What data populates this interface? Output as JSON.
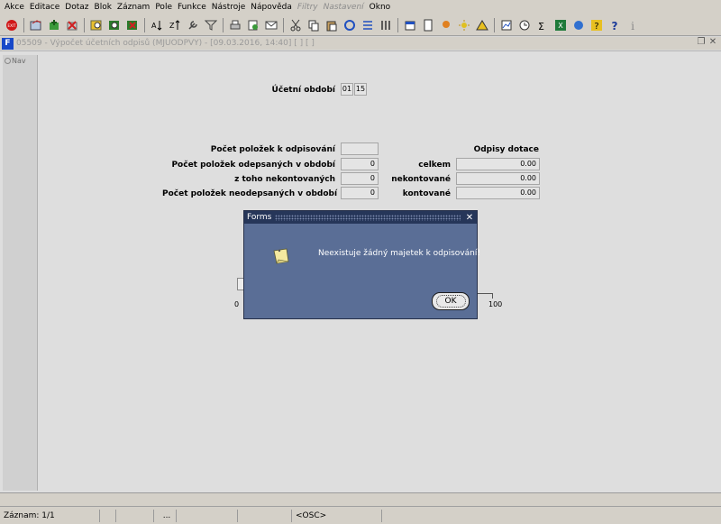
{
  "menu": {
    "items": [
      {
        "label": "Akce",
        "disabled": false
      },
      {
        "label": "Editace",
        "disabled": false
      },
      {
        "label": "Dotaz",
        "disabled": false
      },
      {
        "label": "Blok",
        "disabled": false
      },
      {
        "label": "Záznam",
        "disabled": false
      },
      {
        "label": "Pole",
        "disabled": false
      },
      {
        "label": "Funkce",
        "disabled": false
      },
      {
        "label": "Nástroje",
        "disabled": false
      },
      {
        "label": "Nápověda",
        "disabled": false
      },
      {
        "label": "Filtry",
        "disabled": true
      },
      {
        "label": "Nastavení",
        "disabled": true
      },
      {
        "label": "Okno",
        "disabled": false
      }
    ]
  },
  "window": {
    "title": "05509 - Výpočet účetních odpisů (MJUODPVY) - [09.03.2016, 14:40] [ ] [ ]",
    "app_icon": "F"
  },
  "nav": {
    "label": "Nav"
  },
  "form": {
    "period_label": "Účetní období",
    "period_month": "01",
    "period_year": "15",
    "items_to_depreciate_label": "Počet položek k odpisování",
    "items_to_depreciate_value": "",
    "items_depreciated_label": "Počet položek odepsaných v období",
    "items_depreciated_value": "0",
    "of_which_uncontrolled_label": "z toho nekontovaných",
    "of_which_uncontrolled_value": "0",
    "items_not_depreciated_label": "Počet položek neodepsaných v období",
    "items_not_depreciated_value": "0",
    "subsidy_header": "Odpisy dotace",
    "total_label": "celkem",
    "total_value": "0.00",
    "uncontrolled_label": "nekontované",
    "uncontrolled_value": "0.00",
    "controlled_label": "kontované",
    "controlled_value": "0.00",
    "progress_min": "0",
    "progress_max": "100"
  },
  "dialog": {
    "title": "Forms",
    "message": "Neexistuje žádný majetek k odpisování!",
    "ok_label": "OK",
    "close_glyph": "✕"
  },
  "status": {
    "record": "Záznam: 1/1",
    "ellipsis": "...",
    "mode": "<OSC>"
  }
}
